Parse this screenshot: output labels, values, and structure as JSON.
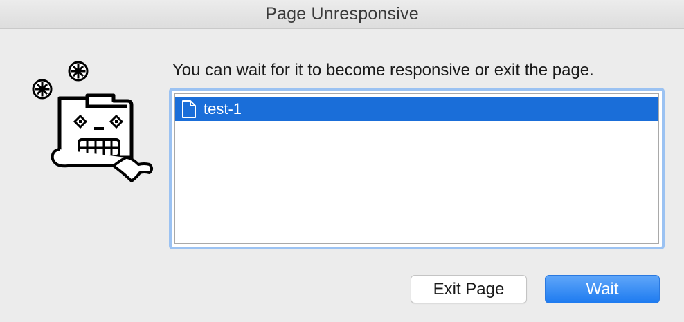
{
  "window": {
    "title": "Page Unresponsive"
  },
  "message": "You can wait for it to become responsive or exit the page.",
  "pages": [
    {
      "label": "test-1",
      "icon": "document-icon",
      "selected": true
    }
  ],
  "buttons": {
    "exit_label": "Exit Page",
    "wait_label": "Wait"
  },
  "illustration": {
    "icon": "frozen-folder-icon",
    "decorations": [
      "snowflake-icon",
      "snowflake-icon"
    ]
  },
  "colors": {
    "selection": "#1a6ed9",
    "focus_ring": "#9bc2f2",
    "primary_button": "#1e7bf0"
  }
}
